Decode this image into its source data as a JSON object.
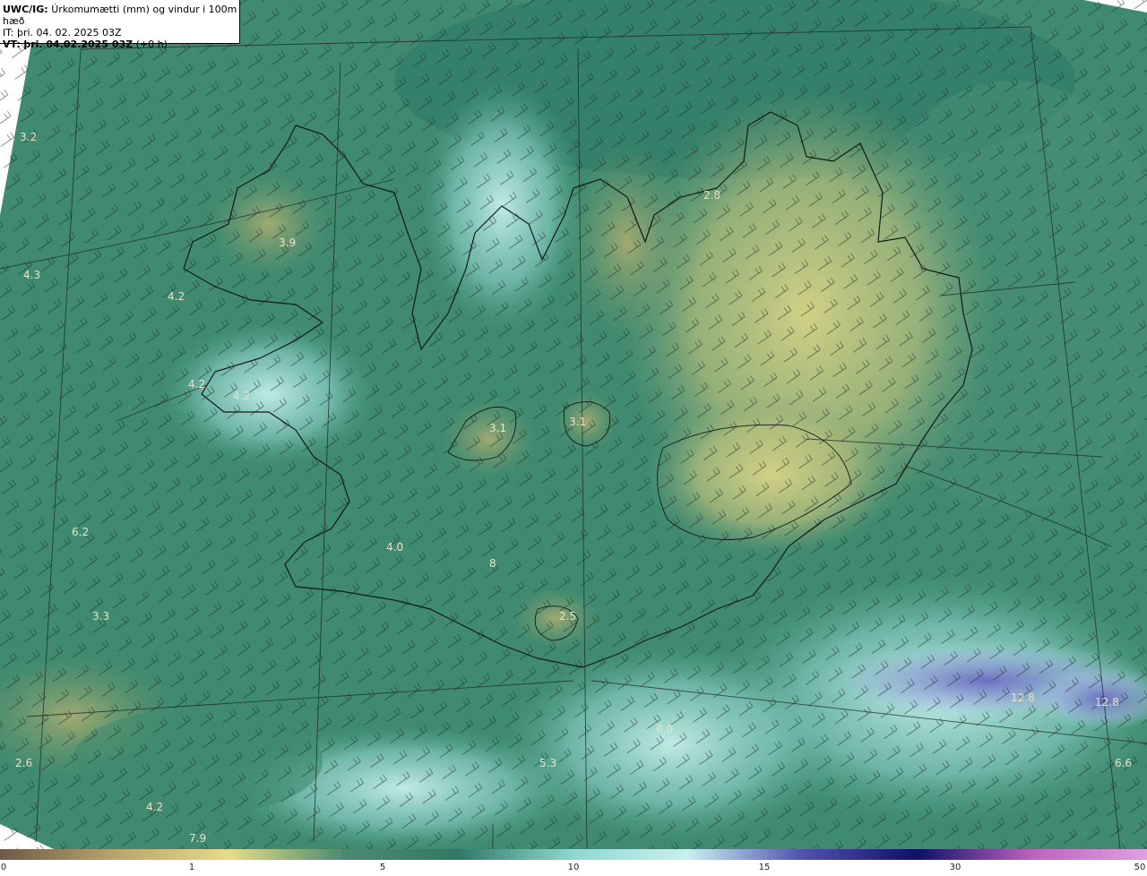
{
  "header": {
    "product": "UWC/IG:",
    "title": "Úrkomumætti (mm) og vindur i 100m hæð",
    "it_label": "IT:",
    "it_value": "þri. 04. 02. 2025 03Z",
    "vt_label": "VT:",
    "vt_value": "þri. 04.02.2025 03Z",
    "vt_offset": "(+0 h)"
  },
  "colorbar": {
    "ticks": [
      "0",
      "1",
      "5",
      "10",
      "15",
      "30",
      "50"
    ],
    "colors": [
      "#6e5a48",
      "#b8a46a",
      "#e8dc88",
      "#4a8a70",
      "#2f7a66",
      "#8ed8d0",
      "#c8f0f0",
      "#5050b0",
      "#10106a",
      "#c060c0",
      "#e0a0e0"
    ]
  },
  "map": {
    "values": [
      {
        "text": "3.2"
      },
      {
        "text": "4.3"
      },
      {
        "text": "3.9"
      },
      {
        "text": "4.2"
      },
      {
        "text": "4.2"
      },
      {
        "text": "4.2"
      },
      {
        "text": "3.1"
      },
      {
        "text": "3.1"
      },
      {
        "text": "2.8"
      },
      {
        "text": "4.0"
      },
      {
        "text": "6.2"
      },
      {
        "text": "3.3"
      },
      {
        "text": "2.5"
      },
      {
        "text": "6.0"
      },
      {
        "text": "5.3"
      },
      {
        "text": "12.8"
      },
      {
        "text": "12.8"
      },
      {
        "text": "6.6"
      },
      {
        "text": "2.6"
      },
      {
        "text": "4.2"
      },
      {
        "text": "7.9"
      },
      {
        "text": "8"
      }
    ]
  }
}
